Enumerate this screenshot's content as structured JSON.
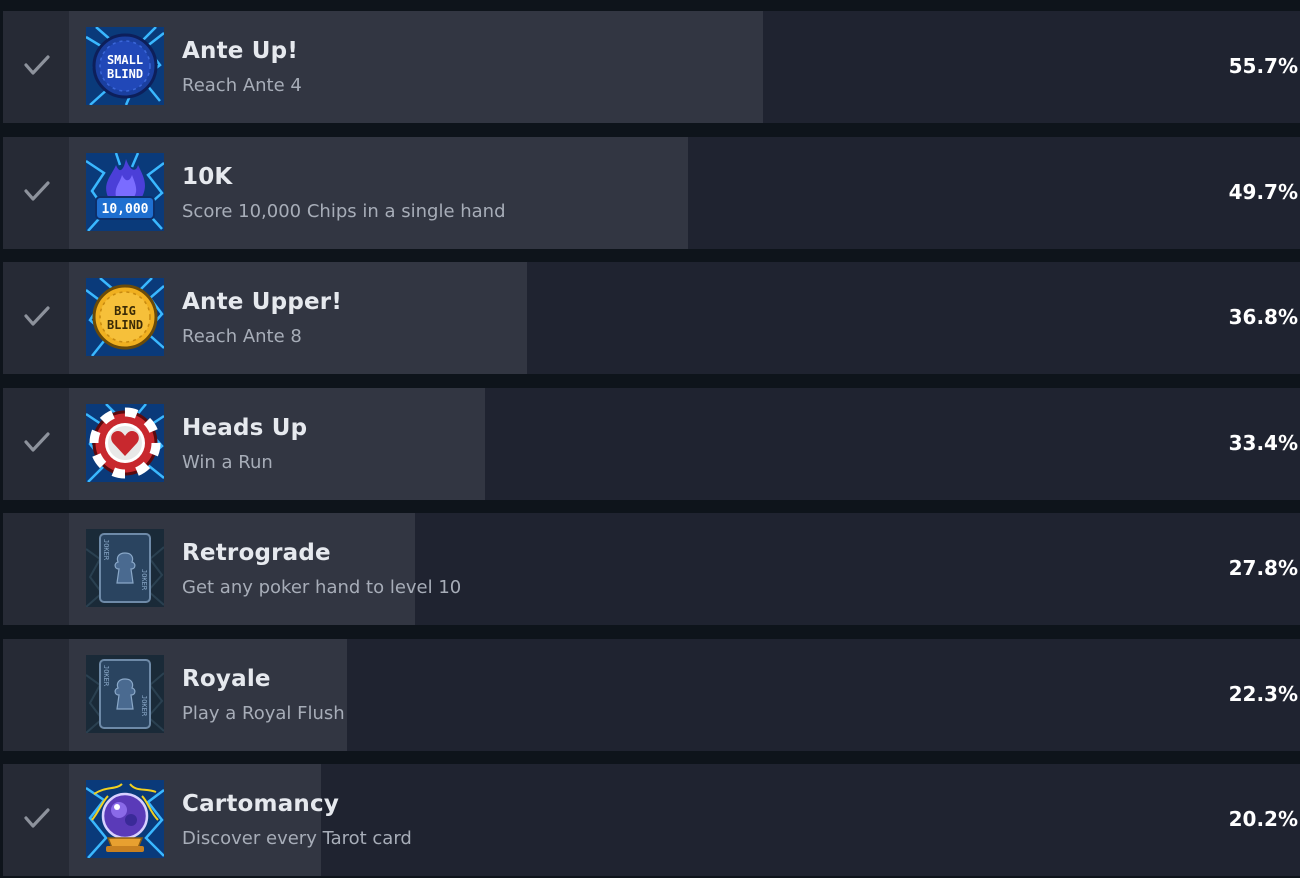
{
  "achievements": [
    {
      "title": "Ante Up!",
      "description": "Reach Ante 4",
      "percent": "55.7%",
      "percent_value": 55.7,
      "unlocked": true,
      "icon": "small-blind-icon",
      "icon_text": [
        "SMALL",
        "BLIND"
      ]
    },
    {
      "title": "10K",
      "description": "Score 10,000 Chips in a single hand",
      "percent": "49.7%",
      "percent_value": 49.7,
      "unlocked": true,
      "icon": "10000-chips-icon",
      "icon_text": [
        "10,000"
      ]
    },
    {
      "title": "Ante Upper!",
      "description": "Reach Ante 8",
      "percent": "36.8%",
      "percent_value": 36.8,
      "unlocked": true,
      "icon": "big-blind-icon",
      "icon_text": [
        "BIG",
        "BLIND"
      ]
    },
    {
      "title": "Heads Up",
      "description": "Win a Run",
      "percent": "33.4%",
      "percent_value": 33.4,
      "unlocked": true,
      "icon": "heart-chip-icon"
    },
    {
      "title": "Retrograde",
      "description": "Get any poker hand to level 10",
      "percent": "27.8%",
      "percent_value": 27.8,
      "unlocked": false,
      "icon": "joker-card-icon",
      "icon_text": [
        "JOKER"
      ]
    },
    {
      "title": "Royale",
      "description": "Play a Royal Flush",
      "percent": "22.3%",
      "percent_value": 22.3,
      "unlocked": false,
      "icon": "joker-card-icon",
      "icon_text": [
        "JOKER"
      ]
    },
    {
      "title": "Cartomancy",
      "description": "Discover every Tarot card",
      "percent": "20.2%",
      "percent_value": 20.2,
      "unlocked": true,
      "icon": "crystal-ball-icon"
    }
  ],
  "colors": {
    "row_background": "#1f2330",
    "progress_fill": "#323642",
    "check_column": "#262a35",
    "check_mark": "#8d929c",
    "title_text": "#e6e9ee",
    "description_text": "#a7adb8",
    "percent_text": "#ffffff",
    "lightning_blue": "#1e90ff",
    "small_blind_blue": "#1c3fae",
    "big_blind_gold": "#f0b020",
    "chip_red": "#c8282e"
  }
}
